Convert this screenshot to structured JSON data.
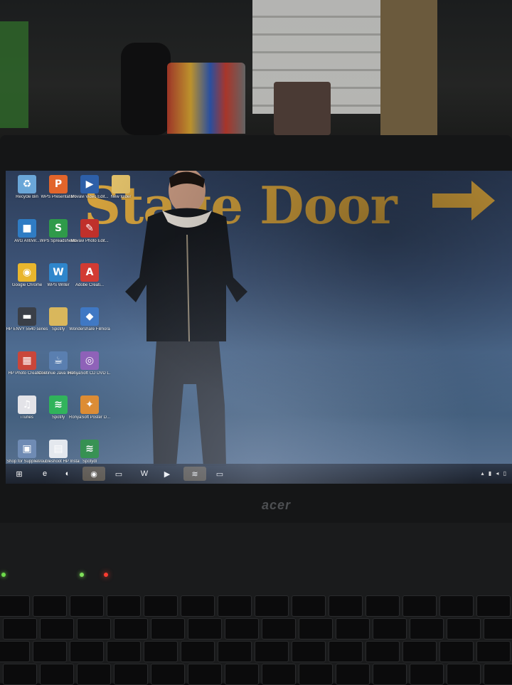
{
  "wallpaper": {
    "title": "Stage Door"
  },
  "brand": "acer",
  "desktop_icons": [
    {
      "label": "Recycle Bin",
      "icon": "recycle-bin-icon",
      "color": "#6aa6d8",
      "glyph": "♻"
    },
    {
      "label": "WPS Presentation",
      "icon": "wps-presentation-icon",
      "color": "#e2652b",
      "glyph": "P"
    },
    {
      "label": "Movavi Video Edit...",
      "icon": "movavi-video-icon",
      "color": "#2d5fa8",
      "glyph": "▶"
    },
    {
      "label": "New folder",
      "icon": "folder-icon",
      "color": "#e1c06a",
      "glyph": ""
    },
    {
      "label": "AVG AntiVir...",
      "icon": "avg-antivirus-icon",
      "color": "#2f7cc4",
      "glyph": "■"
    },
    {
      "label": "WPS Spreadsheets",
      "icon": "wps-spreadsheets-icon",
      "color": "#2f9a4a",
      "glyph": "S"
    },
    {
      "label": "Movavi Photo Edit...",
      "icon": "movavi-photo-icon",
      "color": "#c0302b",
      "glyph": "✎"
    },
    {
      "label": "Google Chrome",
      "icon": "chrome-icon",
      "color": "#e9b62d",
      "glyph": "◉"
    },
    {
      "label": "WPS Writer",
      "icon": "wps-writer-icon",
      "color": "#2f86cc",
      "glyph": "W"
    },
    {
      "label": "Adobe Creati...",
      "icon": "adobe-creative-icon",
      "color": "#d23b33",
      "glyph": "A"
    },
    {
      "label": "HP ENVY 5540 series",
      "icon": "printer-icon",
      "color": "#3a3f48",
      "glyph": "▬"
    },
    {
      "label": "Spotify",
      "icon": "spotify-folder-icon",
      "color": "#d9b75c",
      "glyph": ""
    },
    {
      "label": "Wondershare Filmora",
      "icon": "filmora-icon",
      "color": "#3f78c4",
      "glyph": "◆"
    },
    {
      "label": "HP Photo Creations",
      "icon": "hp-photo-icon",
      "color": "#c9463a",
      "glyph": "▦"
    },
    {
      "label": "Continue Java Insit...",
      "icon": "java-icon",
      "color": "#5a7fb0",
      "glyph": "☕"
    },
    {
      "label": "RonyaSoft CD DVD L...",
      "icon": "ronyasoft-cd-icon",
      "color": "#8e5fb8",
      "glyph": "◎"
    },
    {
      "label": "iTunes",
      "icon": "itunes-icon",
      "color": "#e3e3e8",
      "glyph": "♫"
    },
    {
      "label": "Spotify",
      "icon": "spotify-icon",
      "color": "#2fb35a",
      "glyph": "≋"
    },
    {
      "label": "RonyaSoft Poster D...",
      "icon": "ronyasoft-poster-icon",
      "color": "#e08a2b",
      "glyph": "✦"
    },
    {
      "label": "Shop for Supplies - ...",
      "icon": "shop-supplies-icon",
      "color": "#6f8bb4",
      "glyph": "▣"
    },
    {
      "label": "Troubleshoot HP Installat...",
      "icon": "troubleshoot-icon",
      "color": "#e5e9ef",
      "glyph": "▤"
    },
    {
      "label": "Spotydl",
      "icon": "spotydl-icon",
      "color": "#2f8f4a",
      "glyph": "≋"
    }
  ],
  "taskbar": [
    {
      "icon": "start-orb-icon",
      "glyph": "⊞"
    },
    {
      "icon": "internet-explorer-icon",
      "glyph": "e"
    },
    {
      "icon": "user-icon",
      "glyph": "◐"
    },
    {
      "icon": "chrome-taskbar-icon",
      "glyph": "◉"
    },
    {
      "icon": "file-explorer-icon",
      "glyph": "▭"
    },
    {
      "icon": "wps-writer-taskbar-icon",
      "glyph": "W"
    },
    {
      "icon": "media-player-icon",
      "glyph": "▶"
    },
    {
      "icon": "spotify-taskbar-icon",
      "glyph": "≋"
    },
    {
      "icon": "window-taskbar-icon",
      "glyph": "▭"
    }
  ]
}
